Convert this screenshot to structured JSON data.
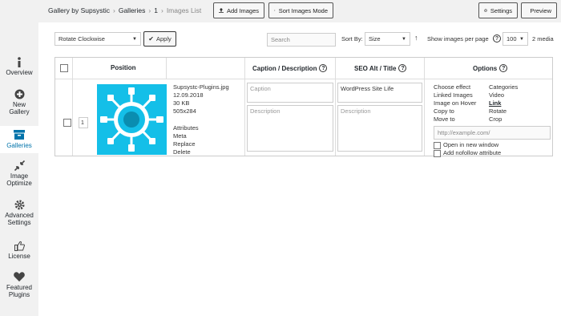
{
  "breadcrumb": {
    "root": "Gallery by Supsystic",
    "galleries": "Galleries",
    "id": "1",
    "current": "Images List"
  },
  "toolbar": {
    "add_images": "Add Images",
    "sort_mode": "Sort Images Mode",
    "settings": "Settings",
    "preview": "Preview"
  },
  "sidebar": {
    "items": [
      {
        "label": "Overview",
        "icon": "info-icon"
      },
      {
        "label": "New Gallery",
        "icon": "plus-circle-icon"
      },
      {
        "label": "Galleries",
        "icon": "archive-icon"
      },
      {
        "label": "Image Optimize",
        "icon": "compress-icon"
      },
      {
        "label": "Advanced Settings",
        "icon": "gear-icon"
      },
      {
        "label": "License",
        "icon": "thumbs-up-icon"
      },
      {
        "label": "Featured Plugins",
        "icon": "heart-icon"
      }
    ]
  },
  "actions": {
    "bulk_select": "Rotate Clockwise",
    "apply": "Apply",
    "search_placeholder": "Search",
    "sort_by_label": "Sort By:",
    "sort_by_value": "Size",
    "per_page_label": "Show images per page",
    "per_page_value": "100",
    "media_count": "2 media"
  },
  "table": {
    "headers": {
      "position": "Position",
      "caption": "Caption / Description",
      "seo": "SEO Alt / Title",
      "options": "Options"
    },
    "rows": [
      {
        "position": "1",
        "filename": "Supsystc-Plugins.jpg",
        "date": "12.09.2018",
        "size": "30 KB",
        "dimensions": "505x284",
        "links": [
          "Attributes",
          "Meta",
          "Replace",
          "Delete"
        ],
        "caption_placeholder": "Caption",
        "description_placeholder": "Description",
        "seo_alt": "WordPress Site Life",
        "seo_description_placeholder": "Description",
        "options_left": [
          "Choose effect",
          "Linked Images",
          "Image on Hover",
          "Copy to",
          "Move to"
        ],
        "options_right": [
          "Categories",
          "Video",
          "Link",
          "Rotate",
          "Crop"
        ],
        "url_placeholder": "http://example.com/",
        "open_new_window": "Open in new window",
        "add_nofollow": "Add nofollow attribute"
      }
    ]
  },
  "colors": {
    "accent": "#0073aa",
    "thumb_bg": "#14bfe8",
    "sidebar_bg": "#f1f1f1"
  }
}
